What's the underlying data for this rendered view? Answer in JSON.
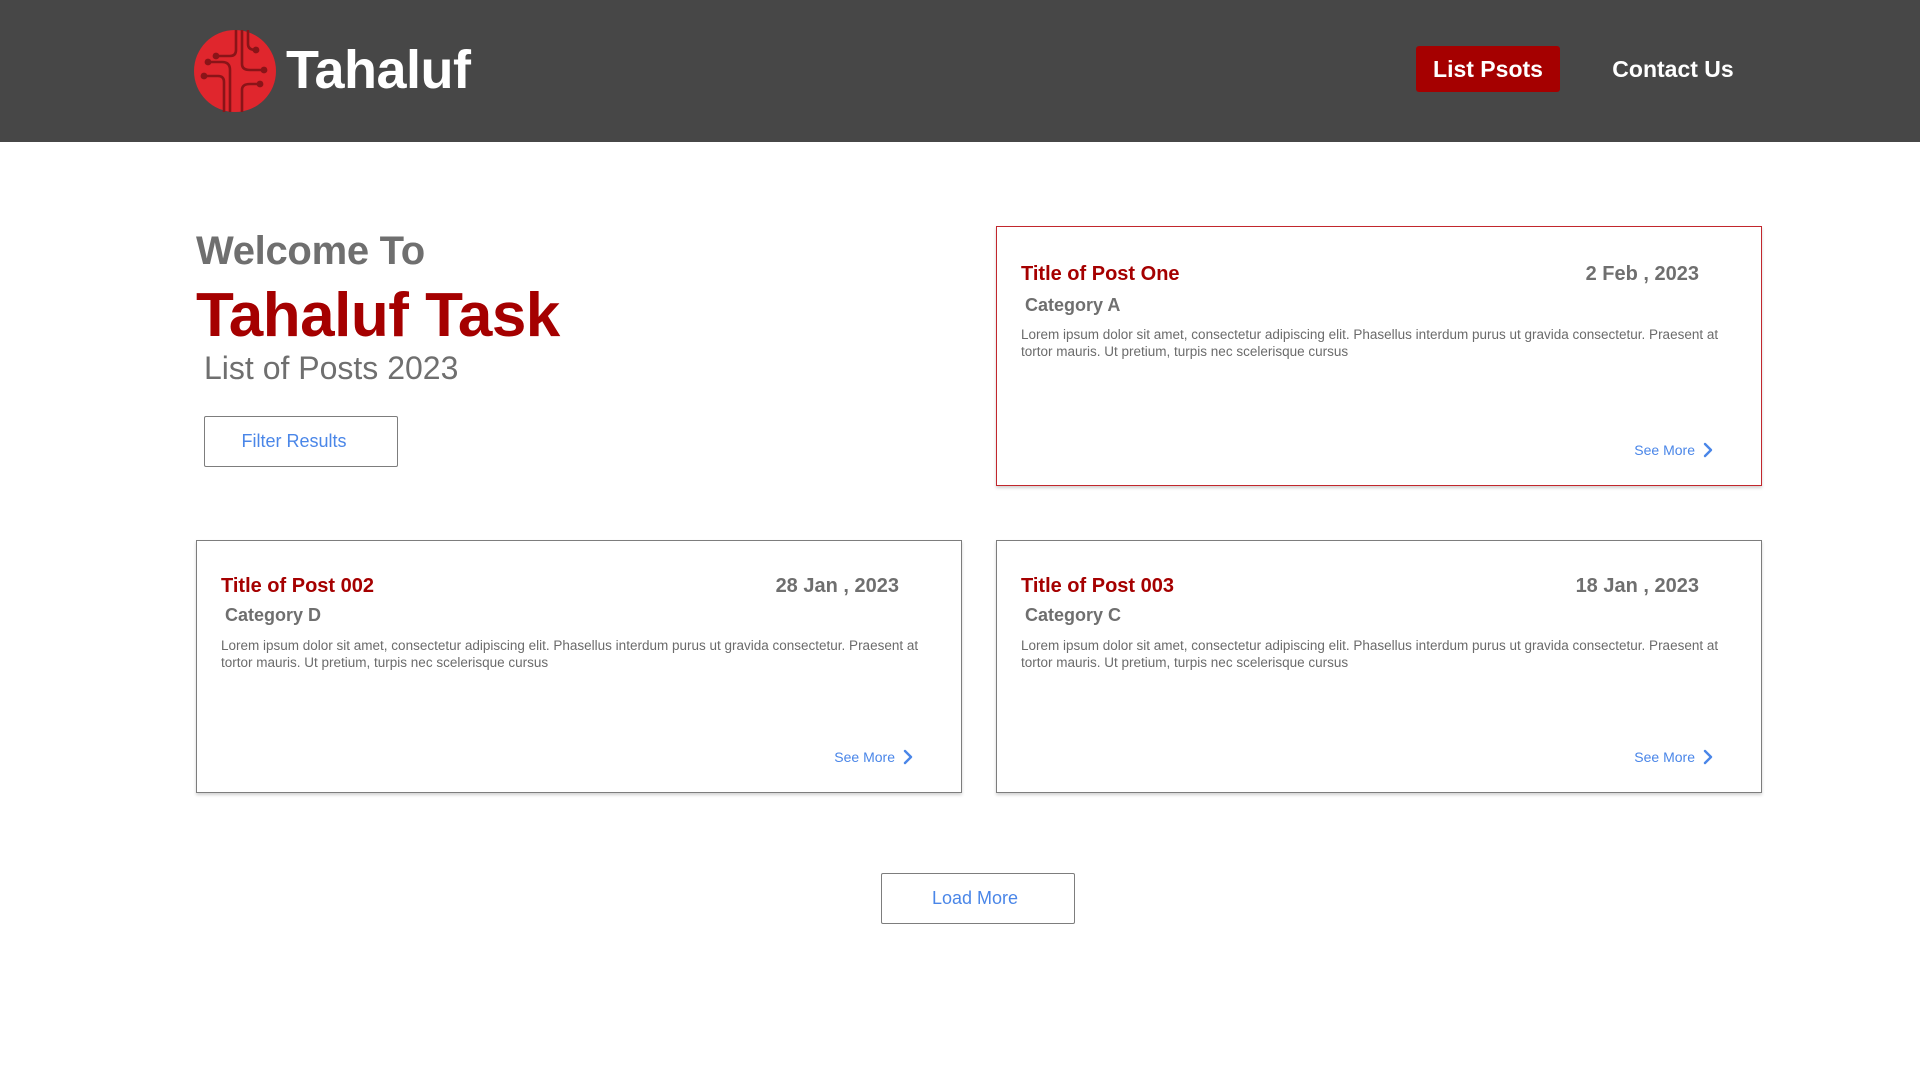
{
  "brand": {
    "name": "Tahaluf",
    "logo_icon": "circuit-circle-logo-icon",
    "brand_color": "#a50000"
  },
  "nav": {
    "items": [
      {
        "label": "List Psots",
        "active": true
      },
      {
        "label": "Contact Us",
        "active": false
      }
    ]
  },
  "hero": {
    "welcome": "Welcome To",
    "title": "Tahaluf Task",
    "subtitle": "List of Posts 2023",
    "filter_label": "Filter Results"
  },
  "posts": [
    {
      "title": "Title of Post One",
      "date": "2 Feb , 2023",
      "category": "Category A",
      "body": "Lorem ipsum dolor sit amet, consectetur adipiscing elit. Phasellus interdum purus ut gravida consectetur. Praesent at tortor mauris. Ut pretium, turpis nec scelerisque cursus",
      "see_more": "See More",
      "highlighted": true
    },
    {
      "title": "Title of Post 002",
      "date": "28 Jan , 2023",
      "category": "Category D",
      "body": "Lorem ipsum dolor sit amet, consectetur adipiscing elit. Phasellus interdum purus ut gravida consectetur. Praesent at tortor mauris. Ut pretium, turpis nec scelerisque cursus",
      "see_more": "See More",
      "highlighted": false
    },
    {
      "title": "Title of Post 003",
      "date": "18 Jan , 2023",
      "category": "Category C",
      "body": "Lorem ipsum dolor sit amet, consectetur adipiscing elit. Phasellus interdum purus ut gravida consectetur. Praesent at tortor mauris. Ut pretium, turpis nec scelerisque cursus",
      "see_more": "See More",
      "highlighted": false
    }
  ],
  "load_more_label": "Load More",
  "colors": {
    "header_bg": "#474747",
    "accent_red": "#a50000",
    "link_blue": "#4a86e8",
    "text_gray": "#6f6f6f"
  }
}
